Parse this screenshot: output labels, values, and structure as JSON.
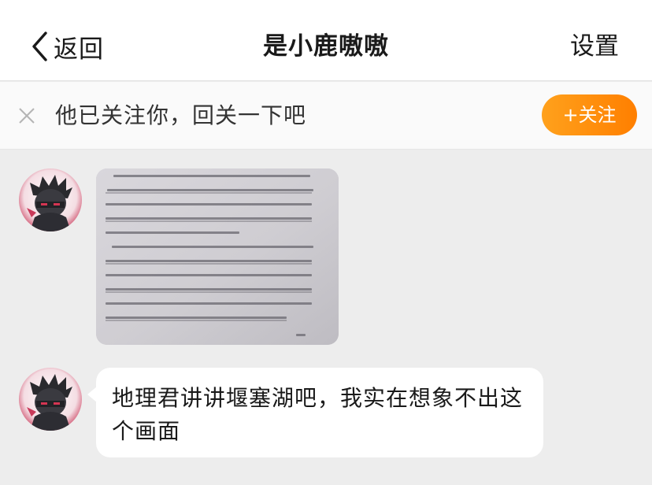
{
  "header": {
    "back_label": "返回",
    "title": "是小鹿嗷嗷",
    "settings_label": "设置"
  },
  "follow_bar": {
    "text": "他已关注你，回关一下吧",
    "button_label": "+关注",
    "button_color": "#ff8a0f"
  },
  "messages": [
    {
      "type": "image",
      "content": "photo of a book page"
    },
    {
      "type": "text",
      "text": "地理君讲讲堰塞湖吧，我实在想象不出这个画面"
    }
  ],
  "colors": {
    "background": "#ededed",
    "header_bg": "#ffffff",
    "accent": "#ff8a0f",
    "bubble_bg": "#ffffff"
  }
}
